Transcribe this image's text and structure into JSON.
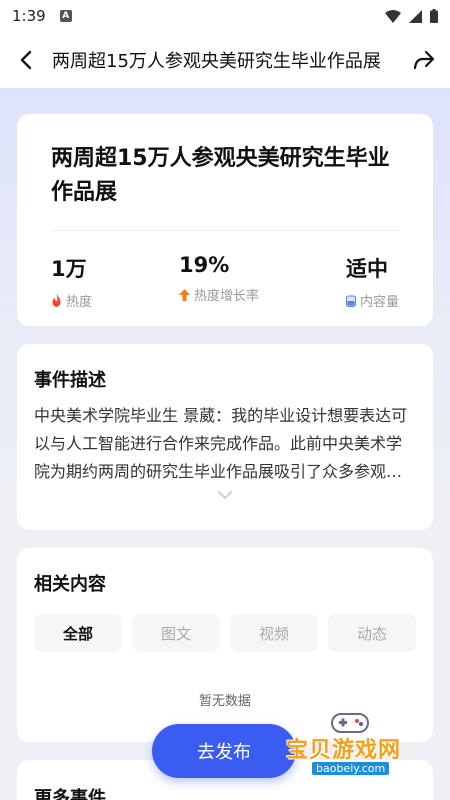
{
  "status_bar": {
    "time": "1:39",
    "notification_icon": "A"
  },
  "header": {
    "title": "两周超15万人参观央美研究生毕业作品展"
  },
  "event": {
    "title": "两周超15万人参观央美研究生毕业作品展",
    "stats": [
      {
        "value": "1万",
        "label": "热度",
        "icon": "flame-icon",
        "color": "#f04a2a"
      },
      {
        "value": "19%",
        "label": "热度增长率",
        "icon": "arrow-up-icon",
        "color": "#f47a1a"
      },
      {
        "value": "适中",
        "label": "内容量",
        "icon": "battery-icon",
        "color": "#5b7df5"
      }
    ]
  },
  "description": {
    "title": "事件描述",
    "text": "中央美术学院毕业生 景葳：我的毕业设计想要表达可以与人工智能进行合作来完成作品。此前中央美术学院为期约两周的研究生毕业作品展吸引了众多参观者……"
  },
  "related": {
    "title": "相关内容",
    "tabs": [
      "全部",
      "图文",
      "视频",
      "动态"
    ],
    "active_tab": 0,
    "empty_text": "暂无数据"
  },
  "more": {
    "title": "更多事件"
  },
  "fab": {
    "label": "去发布"
  },
  "watermark": {
    "text": "宝贝游戏网",
    "url": "baobeiy.com"
  },
  "colors": {
    "accent": "#3b5cf0",
    "background": "#eef0f6"
  }
}
